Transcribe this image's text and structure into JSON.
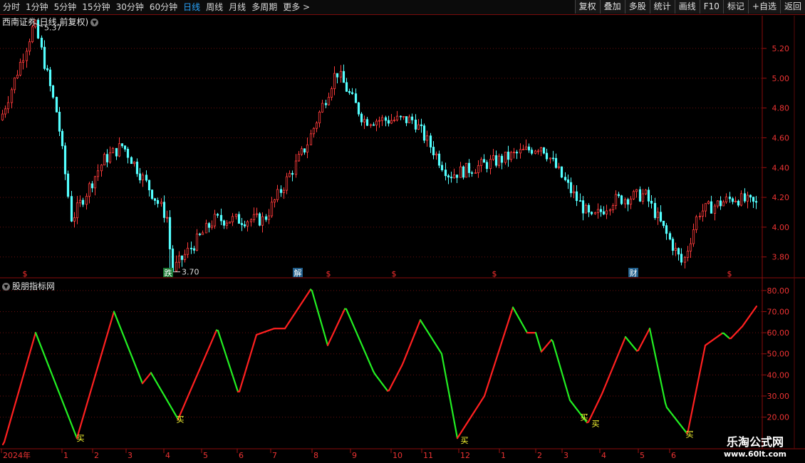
{
  "toolbar": {
    "periods": [
      "分时",
      "1分钟",
      "5分钟",
      "15分钟",
      "30分钟",
      "60分钟",
      "日线",
      "周线",
      "月线",
      "多周期",
      "更多 >"
    ],
    "active_period": "日线",
    "buttons": [
      "复权",
      "叠加",
      "多股",
      "统计",
      "画线",
      "F10",
      "标记",
      "+自选",
      "返回"
    ]
  },
  "price_panel": {
    "title": "西南证券(日线,前复权)",
    "high_label": "5.37",
    "low_label": "3.70",
    "event_markers": [
      {
        "label": "$",
        "x": 35
      },
      {
        "label": "跌",
        "x": 236
      },
      {
        "label": "解",
        "x": 418
      },
      {
        "label": "$",
        "x": 461
      },
      {
        "label": "$",
        "x": 553
      },
      {
        "label": "$",
        "x": 694
      },
      {
        "label": "财",
        "x": 889
      },
      {
        "label": "$",
        "x": 1024
      }
    ]
  },
  "indicator_panel": {
    "title": "股朋指标网",
    "buy_label": "买",
    "buy_signals": [
      {
        "x": 113,
        "v": 10
      },
      {
        "x": 253,
        "v": 19
      },
      {
        "x": 652,
        "v": 9
      },
      {
        "x": 820,
        "v": 20
      },
      {
        "x": 836,
        "v": 17
      },
      {
        "x": 968,
        "v": 12
      }
    ]
  },
  "chart_data": [
    {
      "type": "candlestick",
      "y_axis_ticks": [
        5.2,
        5.0,
        4.8,
        4.6,
        4.4,
        4.2,
        4.0,
        3.8
      ],
      "ylim": [
        3.66,
        5.42
      ],
      "high": 5.37,
      "low": 3.7,
      "key_points": [
        [
          0,
          4.72
        ],
        [
          48,
          5.37
        ],
        [
          80,
          4.75
        ],
        [
          100,
          4.05
        ],
        [
          145,
          4.45
        ],
        [
          172,
          4.55
        ],
        [
          236,
          4.05
        ],
        [
          240,
          3.7
        ],
        [
          300,
          4.05
        ],
        [
          370,
          4.05
        ],
        [
          430,
          4.55
        ],
        [
          472,
          5.05
        ],
        [
          510,
          4.72
        ],
        [
          580,
          4.72
        ],
        [
          630,
          4.35
        ],
        [
          700,
          4.45
        ],
        [
          760,
          4.55
        ],
        [
          800,
          4.25
        ],
        [
          830,
          4.05
        ],
        [
          860,
          4.18
        ],
        [
          905,
          4.22
        ],
        [
          958,
          3.75
        ],
        [
          980,
          4.1
        ],
        [
          1030,
          4.2
        ],
        [
          1062,
          4.15
        ]
      ]
    },
    {
      "type": "line",
      "y_axis_ticks": [
        80.0,
        70.0,
        60.0,
        50.0,
        40.0,
        30.0,
        20.0
      ],
      "ylim": [
        5,
        84
      ],
      "x_axis_labels": [
        "2024年",
        "1",
        "2",
        "3",
        "4",
        "5",
        "6",
        "7",
        "8",
        "9",
        "10",
        "11",
        "12",
        "1",
        "2",
        "3",
        "4",
        "5",
        "6"
      ],
      "key_points": [
        [
          5,
          7
        ],
        [
          50,
          60
        ],
        [
          108,
          10
        ],
        [
          160,
          70
        ],
        [
          200,
          36
        ],
        [
          212,
          41
        ],
        [
          250,
          19
        ],
        [
          305,
          62
        ],
        [
          335,
          31
        ],
        [
          360,
          59
        ],
        [
          385,
          62
        ],
        [
          400,
          62
        ],
        [
          437,
          81
        ],
        [
          460,
          54
        ],
        [
          485,
          72
        ],
        [
          525,
          41
        ],
        [
          545,
          32
        ],
        [
          565,
          45
        ],
        [
          590,
          66
        ],
        [
          620,
          50
        ],
        [
          642,
          10
        ],
        [
          680,
          30
        ],
        [
          720,
          72
        ],
        [
          740,
          60
        ],
        [
          752,
          60
        ],
        [
          760,
          51
        ],
        [
          775,
          57
        ],
        [
          800,
          28
        ],
        [
          825,
          17
        ],
        [
          845,
          31
        ],
        [
          878,
          58
        ],
        [
          895,
          51
        ],
        [
          912,
          62
        ],
        [
          935,
          25
        ],
        [
          965,
          12
        ],
        [
          990,
          54
        ],
        [
          1015,
          60
        ],
        [
          1025,
          57
        ],
        [
          1042,
          63
        ],
        [
          1063,
          73
        ]
      ],
      "color_rule": "red when rising, green when falling"
    }
  ]
}
